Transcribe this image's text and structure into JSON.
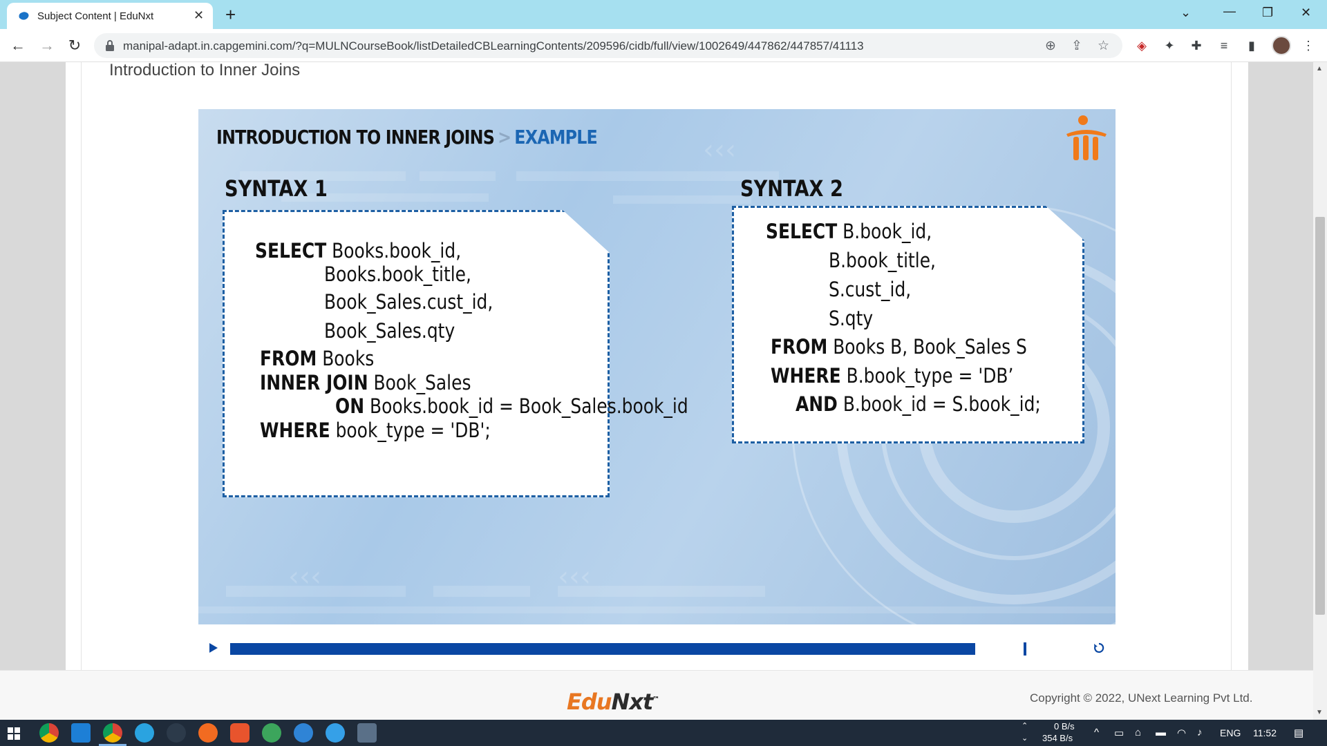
{
  "browser": {
    "tab_title": "Subject Content | EduNxt",
    "url": "manipal-adapt.in.capgemini.com/?q=MULNCourseBook/listDetailedCBLearningContents/209596/cidb/full/view/1002649/447862/447857/41113"
  },
  "page": {
    "heading": "Introduction to Inner Joins"
  },
  "slide": {
    "title_main": "INTRODUCTION TO INNER JOINS",
    "title_sep": ">",
    "title_accent": "EXAMPLE",
    "syntax1": {
      "heading": "SYNTAX 1",
      "lines": [
        {
          "kw": "SELECT",
          "text": " Books.book_id,"
        },
        {
          "kw": "",
          "text": "Books.book_title,"
        },
        {
          "kw": "",
          "text": "Book_Sales.cust_id,"
        },
        {
          "kw": "",
          "text": "Book_Sales.qty"
        },
        {
          "kw": "FROM",
          "text": "  Books"
        },
        {
          "kw": "INNER JOIN",
          "text": " Book_Sales"
        },
        {
          "kw": "ON",
          "text": " Books.book_id  =  Book_Sales.book_id"
        },
        {
          "kw": "WHERE",
          "text": " book_type = 'DB';"
        }
      ]
    },
    "syntax2": {
      "heading": "SYNTAX 2",
      "lines": [
        {
          "kw": "SELECT",
          "text": " B.book_id,"
        },
        {
          "kw": "",
          "text": "B.book_title,"
        },
        {
          "kw": "",
          "text": "S.cust_id,"
        },
        {
          "kw": "",
          "text": "S.qty"
        },
        {
          "kw": "FROM",
          "text": "  Books B, Book_Sales S"
        },
        {
          "kw": "WHERE",
          "text": "  B.book_type = 'DB’"
        },
        {
          "kw": "AND",
          "text": "  B.book_id = S.book_id;"
        }
      ]
    }
  },
  "player": {
    "progress_fraction": 1.0
  },
  "footer": {
    "logo_edu": "Edu",
    "logo_nxt": "Nxt",
    "logo_tm": "™",
    "copyright": "Copyright © 2022, UNext Learning Pvt Ltd."
  },
  "taskbar": {
    "net_down": "0 B/s",
    "net_up": "354 B/s",
    "language": "ENG",
    "time": "11:52"
  },
  "colors": {
    "accent_blue": "#1b66b3",
    "progress_blue": "#0a47a3",
    "brand_orange": "#e87722",
    "tab_bar": "#a6e0f0"
  }
}
